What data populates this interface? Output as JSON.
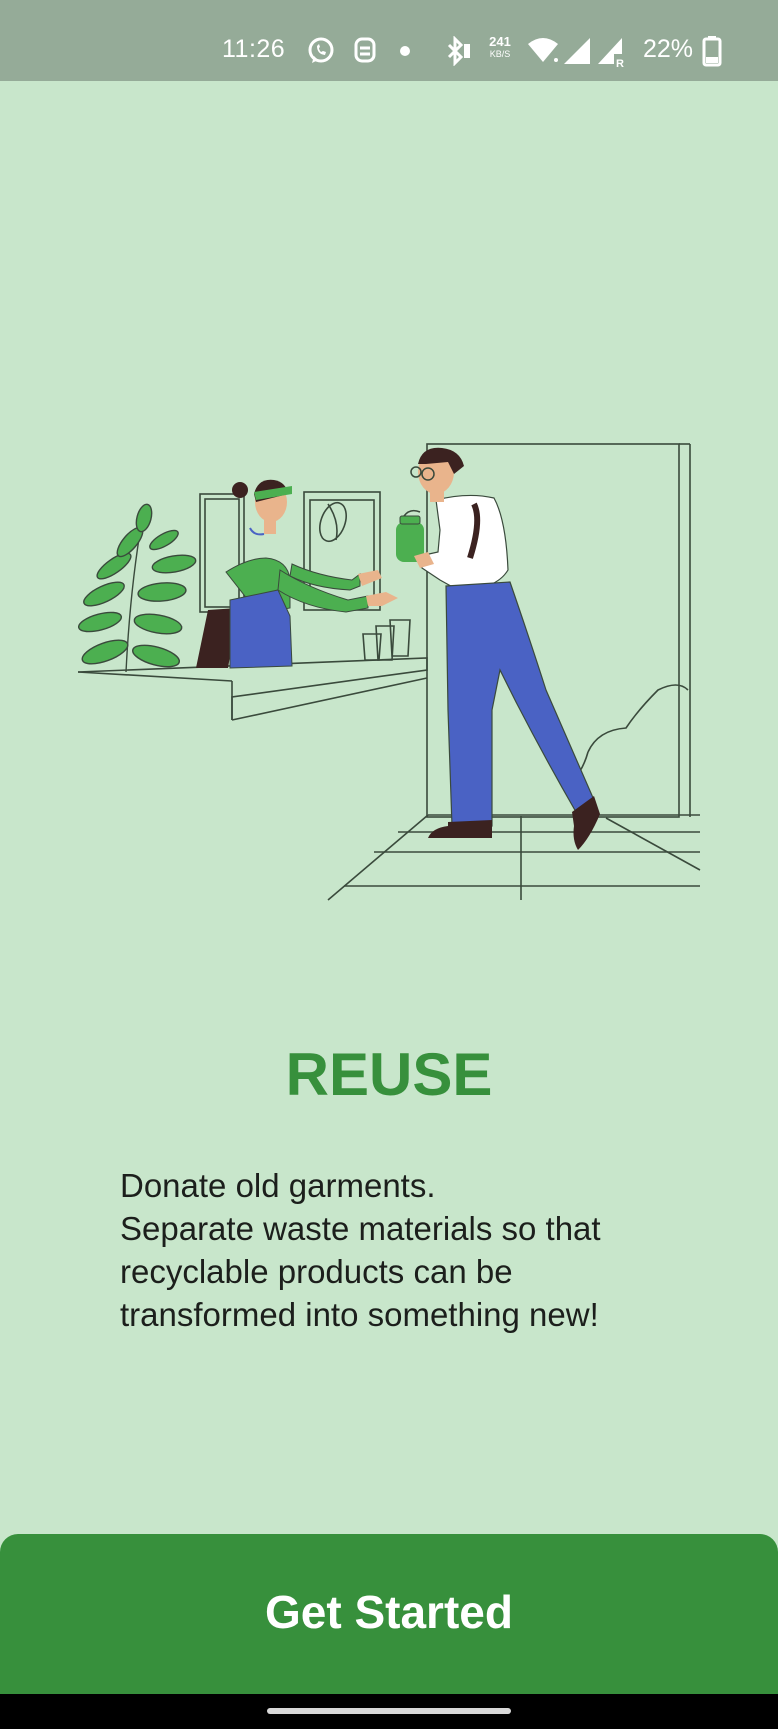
{
  "status_bar": {
    "time": "11:26",
    "net_speed_value": "241",
    "net_speed_unit": "KB/S",
    "battery_percent": "22%",
    "icons": [
      "whatsapp-icon",
      "message-icon",
      "dot-icon",
      "bluetooth-icon",
      "vibrate-icon",
      "wifi-icon",
      "signal-icon",
      "signal-roaming-icon",
      "battery-icon"
    ]
  },
  "onboarding": {
    "title": "REUSE",
    "description_lines": [
      "Donate old garments.",
      "Separate waste materials so that",
      "recyclable products can be",
      "transformed into something new!"
    ]
  },
  "actions": {
    "get_started_label": "Get Started"
  },
  "colors": {
    "background": "#c8e6cb",
    "status_bar": "#95ab98",
    "accent": "#37903c",
    "figure_blue": "#4a62c4",
    "plant_green": "#4caf50"
  }
}
